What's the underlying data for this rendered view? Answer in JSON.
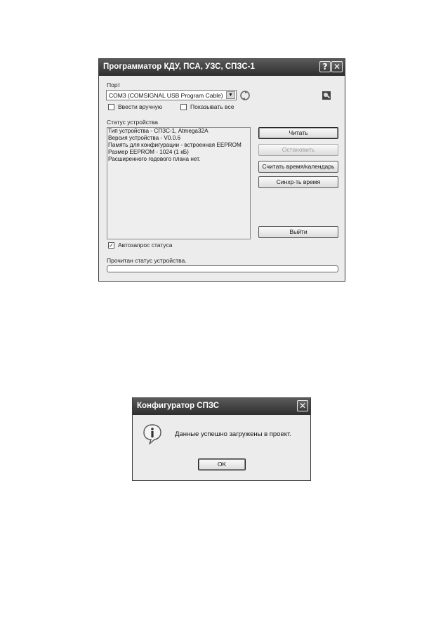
{
  "programmer": {
    "title": "Программатор КДУ, ПСА, УЗС, СПЗС-1",
    "help_button": "?",
    "close_button": "✕",
    "port_label": "Порт",
    "port_value": "COM3 (COMSIGNAL USB Program Cable)",
    "manual_entry_label": "Ввести вручную",
    "manual_entry_checked": false,
    "show_all_label": "Показывать все",
    "show_all_checked": false,
    "status_label": "Статус устройства",
    "status_lines": [
      "Тип устройства - СПЗС-1, Atmega32A",
      "Версия устройства - V0.0.6",
      "Память для конфигурации - встроенная EEPROM",
      "Размер EEPROM - 1024 (1 кБ)",
      "Расширенного годового плана нет."
    ],
    "buttons": {
      "read": "Читать",
      "stop": "Остановить",
      "read_time": "Считать время/календарь",
      "sync_time": "Синхр-ть время",
      "exit": "Выйти"
    },
    "auto_status_label": "Автозапрос статуса",
    "auto_status_checked": true,
    "status_message": "Прочитан статус устройства.",
    "progress_value": 0
  },
  "configurator": {
    "title": "Конфигуратор СПЗС",
    "close_button": "✕",
    "message": "Данные успешно загружены в проект.",
    "ok_label": "OK",
    "icon": "info-icon"
  },
  "colors": {
    "titlebar": "#3a3a3a",
    "window_bg": "#ececec"
  }
}
